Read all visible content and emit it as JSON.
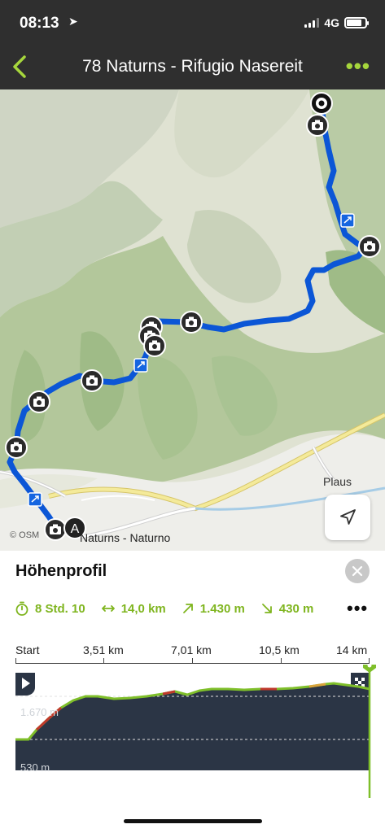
{
  "status_bar": {
    "time": "08:13",
    "network": "4G",
    "signal_bars": 3,
    "battery_level": 0.8
  },
  "nav": {
    "title": "78 Naturns - Rifugio Nasereit",
    "back_icon": "chevron-left-icon",
    "more_icon": "ellipsis-icon",
    "accent": "#a6d63c"
  },
  "map": {
    "attribution": "© OSM",
    "places": {
      "plaus": "Plaus",
      "naturns": "Naturns - Naturno"
    },
    "start_marker_label": "A",
    "route_color": "#1565e0",
    "locate_icon": "location-arrow-icon"
  },
  "profile": {
    "title": "Höhenprofil",
    "stats": {
      "duration": "8 Std. 10",
      "distance": "14,0 km",
      "ascent": "1.430 m",
      "descent": "430 m"
    },
    "axis_labels": [
      "Start",
      "3,51 km",
      "7,01 km",
      "10,5 km",
      "14 km"
    ],
    "elevation_max_label": "1.670 m",
    "elevation_min_label": "530 m",
    "start_icon": "play-icon",
    "finish_icon": "finish-flag-icon",
    "colors": {
      "fill": "#2b3545",
      "line": "#7fbf2a",
      "accent": "#7fb51f"
    }
  }
}
